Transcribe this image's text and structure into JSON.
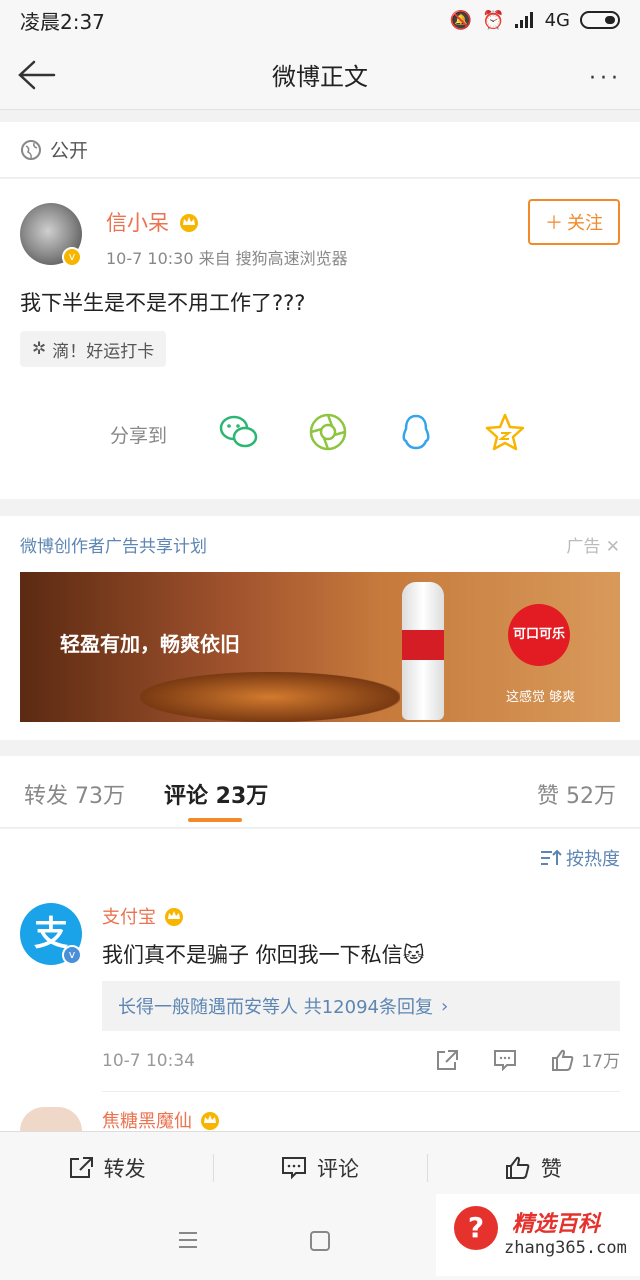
{
  "status_bar": {
    "time": "凌晨2:37",
    "network": "4G"
  },
  "nav": {
    "title": "微博正文",
    "more": "···"
  },
  "visibility": {
    "label": "公开"
  },
  "post": {
    "author": "信小呆",
    "time_source": "10-7 10:30  来自 搜狗高速浏览器",
    "follow_label": "关注",
    "text": "我下半生是不是不用工作了???",
    "tag": "滴！好运打卡",
    "share_label": "分享到"
  },
  "ad": {
    "title": "微博创作者广告共享计划",
    "label": "广告",
    "slogan": "轻盈有加，畅爽依旧",
    "brand": "可口可乐",
    "tagline": "这感觉 够爽"
  },
  "tabs": {
    "repost": "转发 73万",
    "comment": "评论 23万",
    "like": "赞 52万"
  },
  "comments": {
    "sort_label": "按热度",
    "items": [
      {
        "author": "支付宝",
        "avatar_char": "支",
        "text": "我们真不是骗子 你回我一下私信",
        "replies": "长得一般随遇而安等人  共12094条回复",
        "time": "10-7 10:34",
        "likes": "17万"
      },
      {
        "author": "焦糖黑魔仙"
      }
    ]
  },
  "action_bar": {
    "repost": "转发",
    "comment": "评论",
    "like": "赞"
  },
  "watermark": {
    "title": "精选百科",
    "url": "zhang365.com",
    "mark": "?"
  },
  "colors": {
    "accent_orange": "#f28a2a",
    "name_orange": "#eb7350",
    "link_blue": "#5d86b3"
  }
}
